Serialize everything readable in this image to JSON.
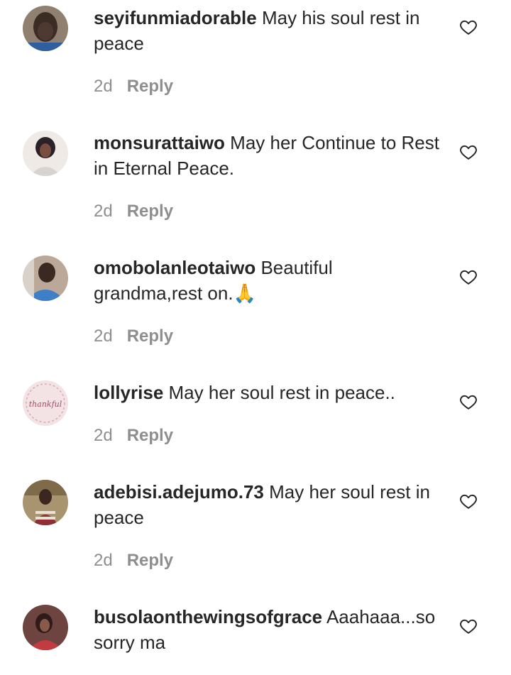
{
  "comments": [
    {
      "username": "seyifunmiadorable",
      "text": "May his soul rest in peace",
      "time": "2d",
      "reply": "Reply",
      "like_icon": "heart-outline-icon",
      "avatar_colors": [
        "#8a7a66",
        "#3a2e27"
      ]
    },
    {
      "username": "monsurattaiwo",
      "text": "May her Continue to Rest in Eternal Peace.",
      "time": "2d",
      "reply": "Reply",
      "like_icon": "heart-outline-icon",
      "avatar_colors": [
        "#f1ece9",
        "#2b2128"
      ]
    },
    {
      "username": "omobolanleotaiwo",
      "text": "Beautiful grandma,rest on.🙏",
      "time": "2d",
      "reply": "Reply",
      "like_icon": "heart-outline-icon",
      "avatar_colors": [
        "#b9a79a",
        "#2f6fb6"
      ]
    },
    {
      "username": "lollyrise",
      "text": "May her soul rest in peace..",
      "time": "2d",
      "reply": "Reply",
      "like_icon": "heart-outline-icon",
      "avatar_colors": [
        "#f3dfe2",
        "#a04d5f"
      ],
      "avatar_text": "thankful"
    },
    {
      "username": "adebisi.adejumo.73",
      "text": "May her soul rest in peace",
      "time": "2d",
      "reply": "Reply",
      "like_icon": "heart-outline-icon",
      "avatar_colors": [
        "#b8a37c",
        "#7a2a2a"
      ]
    },
    {
      "username": "busolaonthewingsofgrace",
      "text": "Aaahaaa...so sorry ma",
      "time": "",
      "reply": "",
      "like_icon": "heart-outline-icon",
      "avatar_colors": [
        "#6b3f3c",
        "#c0393d"
      ]
    }
  ]
}
